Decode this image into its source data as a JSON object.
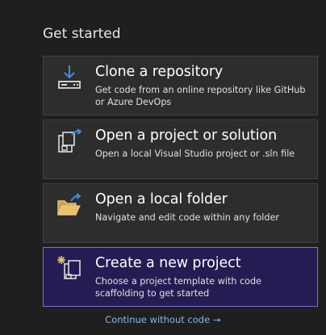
{
  "heading": "Get started",
  "cards": [
    {
      "icon": "clone-download-icon",
      "title": "Clone a repository",
      "description": "Get code from an online repository like GitHub or Azure DevOps"
    },
    {
      "icon": "open-project-icon",
      "title": "Open a project or solution",
      "description": "Open a local Visual Studio project or .sln file"
    },
    {
      "icon": "open-folder-icon",
      "title": "Open a local folder",
      "description": "Navigate and edit code within any folder"
    },
    {
      "icon": "new-project-icon",
      "title": "Create a new project",
      "description": "Choose a project template with code scaffolding to get started",
      "selected": true
    }
  ],
  "continue_link": {
    "label": "Continue without code",
    "arrow": "→"
  },
  "colors": {
    "background": "#1f1f1f",
    "card_background": "#2d2d2d",
    "selected_background": "#241c52",
    "selected_border": "#7a6fdc",
    "link": "#8cb4e8",
    "icon_blue": "#3c8ee8",
    "folder_yellow": "#e8c26c"
  }
}
